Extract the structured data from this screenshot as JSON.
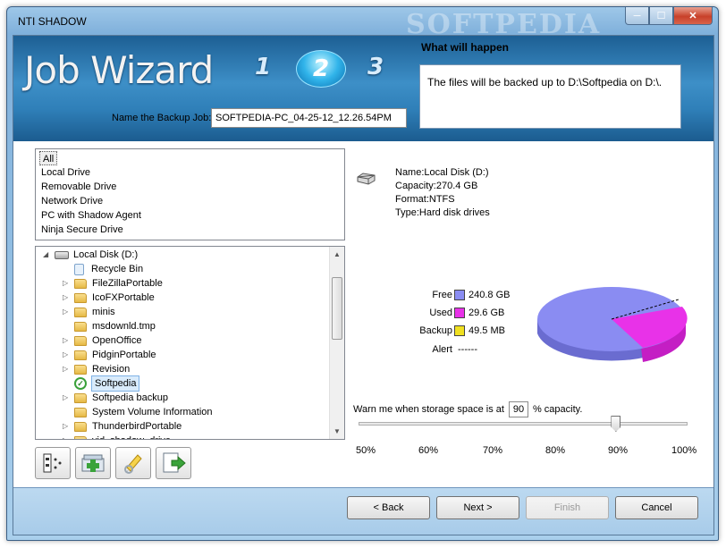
{
  "window": {
    "title": "NTI SHADOW",
    "watermark": "SOFTPEDIA",
    "buttons": {
      "minimize": "─",
      "maximize": "☐",
      "close": "✕"
    }
  },
  "header": {
    "title": "Job Wizard",
    "steps": [
      "1",
      "2",
      "3"
    ],
    "active_step": "2",
    "what_will_happen_label": "What will happen",
    "what_will_happen_text": "The files will be backed up to D:\\Softpedia on D:\\.",
    "job_name_label": "Name the Backup Job:",
    "job_name_value": "SOFTPEDIA-PC_04-25-12_12.26.54PM"
  },
  "drive_types": [
    "All",
    "Local Drive",
    "Removable Drive",
    "Network Drive",
    "PC with Shadow Agent",
    "Ninja Secure Drive"
  ],
  "tree": {
    "root": "Local Disk (D:)",
    "items": [
      "Recycle Bin",
      "FileZillaPortable",
      "IcoFXPortable",
      "minis",
      "msdownld.tmp",
      "OpenOffice",
      "PidginPortable",
      "Revision",
      "Softpedia",
      "Softpedia backup",
      "System Volume Information",
      "ThunderbirdPortable",
      "vid_shadow_drive"
    ]
  },
  "drive_info": {
    "name": "Name:Local Disk (D:)",
    "capacity": "Capacity:270.4 GB",
    "format": "Format:NTFS",
    "type": "Type:Hard disk drives"
  },
  "legend": {
    "free_label": "Free",
    "free_value": "240.8 GB",
    "free_color": "#8a8cf2",
    "used_label": "Used",
    "used_value": "29.6 GB",
    "used_color": "#e832e8",
    "backup_label": "Backup",
    "backup_value": "49.5 MB",
    "backup_color": "#f0e020",
    "alert_label": "Alert",
    "alert_value": "------"
  },
  "warning": {
    "prefix": "Warn me when storage space is at",
    "value": "90",
    "suffix": "% capacity.",
    "level_percent": 90,
    "ticks": [
      "50%",
      "60%",
      "70%",
      "80%",
      "90%",
      "100%"
    ]
  },
  "toolbar_icons": [
    "properties-icon",
    "add-icon",
    "edit-icon",
    "export-icon"
  ],
  "nav": {
    "back": "< Back",
    "next": "Next >",
    "finish": "Finish",
    "cancel": "Cancel"
  }
}
